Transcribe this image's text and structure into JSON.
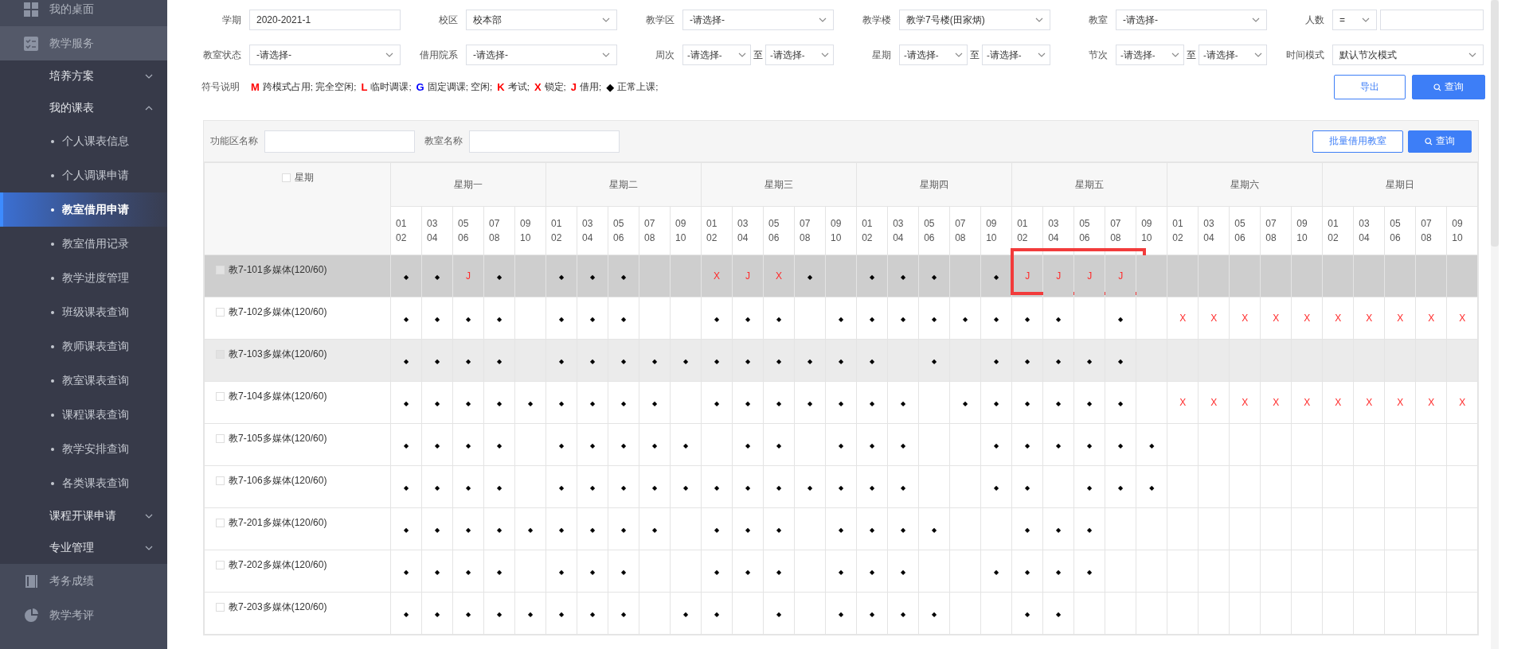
{
  "sidebar": {
    "items": [
      {
        "label": "我的桌面",
        "expanded": false
      },
      {
        "label": "教学服务",
        "expanded": true,
        "children": [
          {
            "label": "培养方案",
            "expanded": false
          },
          {
            "label": "我的课表",
            "expanded": true,
            "children": [
              {
                "label": "个人课表信息",
                "selected": false
              },
              {
                "label": "个人调课申请",
                "selected": false
              },
              {
                "label": "教室借用申请",
                "selected": true
              },
              {
                "label": "教室借用记录",
                "selected": false
              },
              {
                "label": "教学进度管理",
                "selected": false
              },
              {
                "label": "班级课表查询",
                "selected": false
              },
              {
                "label": "教师课表查询",
                "selected": false
              },
              {
                "label": "教室课表查询",
                "selected": false
              },
              {
                "label": "课程课表查询",
                "selected": false
              },
              {
                "label": "教学安排查询",
                "selected": false
              },
              {
                "label": "各类课表查询",
                "selected": false
              }
            ]
          },
          {
            "label": "课程开课申请",
            "expanded": false
          },
          {
            "label": "专业管理",
            "expanded": false
          }
        ]
      },
      {
        "label": "考务成绩",
        "expanded": false
      },
      {
        "label": "教学考评",
        "expanded": false
      }
    ]
  },
  "filters": [
    {
      "label": "学期",
      "kind": "input",
      "value": "2020-2021-1"
    },
    {
      "label": "校区",
      "kind": "select",
      "value": "校本部"
    },
    {
      "label": "教学区",
      "kind": "select",
      "value": "-请选择-"
    },
    {
      "label": "教学楼",
      "kind": "select",
      "value": "教学7号楼(田家炳)"
    },
    {
      "label": "教室",
      "kind": "select",
      "value": "-请选择-"
    },
    {
      "label": "人数",
      "kind": "compare",
      "operator": "="
    },
    {
      "label": "教室状态",
      "kind": "select",
      "value": "-请选择-"
    },
    {
      "label": "借用院系",
      "kind": "select",
      "value": "-请选择-"
    },
    {
      "label": "周次",
      "kind": "range",
      "from": "-请选择-",
      "separator": "至",
      "to": "-请选择-"
    },
    {
      "label": "星期",
      "kind": "range",
      "from": "-请选择-",
      "separator": "至",
      "to": "-请选择-"
    },
    {
      "label": "节次",
      "kind": "range",
      "from": "-请选择-",
      "separator": "至",
      "to": "-请选择-"
    },
    {
      "label": "时间模式",
      "kind": "select",
      "value": "默认节次模式"
    }
  ],
  "legend": {
    "label": "符号说明",
    "items": [
      {
        "symbol": "M",
        "text": "跨模式占用; 完全空闲;",
        "color": "#ff0000"
      },
      {
        "symbol": "L",
        "text": "临时调课;",
        "color": "#ff0000"
      },
      {
        "symbol": "G",
        "text": "固定调课; 空闲;",
        "color": "#0000ff"
      },
      {
        "symbol": "K",
        "text": "考试;",
        "color": "#ff0000"
      },
      {
        "symbol": "X",
        "text": "锁定;",
        "color": "#ff0000"
      },
      {
        "symbol": "J",
        "text": "借用;",
        "color": "#ff0000"
      },
      {
        "symbol": "◆",
        "text": "正常上课;",
        "color": "#000000"
      }
    ]
  },
  "actions": [
    {
      "label": "导出",
      "kind": "outline"
    },
    {
      "label": "查询",
      "kind": "primary"
    }
  ],
  "table": {
    "toolbar": {
      "fields": [
        {
          "label": "功能区名称"
        },
        {
          "label": "教室名称"
        }
      ],
      "buttons": [
        {
          "label": "批量借用教室",
          "kind": "outline"
        },
        {
          "label": "查询",
          "kind": "primary"
        }
      ]
    },
    "corner": {
      "label": "星期",
      "checked": false
    },
    "days": [
      {
        "label": "星期一",
        "periods": [
          "01\n02",
          "03\n04",
          "05\n06",
          "07\n08",
          "09\n10"
        ]
      },
      {
        "label": "星期二",
        "periods": [
          "01\n02",
          "03\n04",
          "05\n06",
          "07\n08",
          "09\n10"
        ]
      },
      {
        "label": "星期三",
        "periods": [
          "01\n02",
          "03\n04",
          "05\n06",
          "07\n08",
          "09\n10"
        ]
      },
      {
        "label": "星期四",
        "periods": [
          "01\n02",
          "03\n04",
          "05\n06",
          "07\n08",
          "09\n10"
        ]
      },
      {
        "label": "星期五",
        "periods": [
          "01\n02",
          "03\n04",
          "05\n06",
          "07\n08",
          "09\n10"
        ]
      },
      {
        "label": "星期六",
        "periods": [
          "01\n02",
          "03\n04",
          "05\n06",
          "07\n08",
          "09\n10"
        ]
      },
      {
        "label": "星期日",
        "periods": [
          "01\n02",
          "03\n04",
          "05\n06",
          "07\n08",
          "09\n10"
        ]
      }
    ],
    "rows": [
      {
        "room": "教7-101多媒体(120/60)",
        "checked": false,
        "selected": true,
        "hovered": false,
        "days": [
          {
            "slots": [
              {
                "mark": "◆",
                "kind": "normal"
              },
              {
                "mark": "◆",
                "kind": "normal"
              },
              {
                "mark": "J",
                "kind": "borrow"
              },
              {
                "mark": "◆",
                "kind": "normal"
              },
              {
                "kind": "free"
              }
            ]
          },
          {
            "slots": [
              {
                "mark": "◆",
                "kind": "normal"
              },
              {
                "mark": "◆",
                "kind": "normal"
              },
              {
                "mark": "◆",
                "kind": "normal"
              },
              {
                "kind": "free"
              },
              {
                "kind": "free"
              }
            ]
          },
          {
            "slots": [
              {
                "mark": "X",
                "kind": "locked"
              },
              {
                "mark": "J",
                "kind": "borrow"
              },
              {
                "mark": "X",
                "kind": "locked"
              },
              {
                "mark": "◆",
                "kind": "normal"
              },
              {
                "kind": "free"
              }
            ]
          },
          {
            "slots": [
              {
                "mark": "◆",
                "kind": "normal"
              },
              {
                "mark": "◆",
                "kind": "normal"
              },
              {
                "mark": "◆",
                "kind": "normal"
              },
              {
                "kind": "free"
              },
              {
                "mark": "◆",
                "kind": "normal"
              }
            ]
          },
          {
            "slots": [
              {
                "mark": "J",
                "kind": "borrow"
              },
              {
                "mark": "J",
                "kind": "borrow"
              },
              {
                "mark": "J",
                "kind": "borrow"
              },
              {
                "mark": "J",
                "kind": "borrow"
              },
              {
                "kind": "free"
              }
            ],
            "annotated": true
          },
          {
            "slots": [
              {
                "kind": "free"
              },
              {
                "kind": "free"
              },
              {
                "kind": "free"
              },
              {
                "kind": "free"
              },
              {
                "kind": "free"
              }
            ]
          },
          {
            "slots": [
              {
                "kind": "free"
              },
              {
                "kind": "free"
              },
              {
                "kind": "free"
              },
              {
                "kind": "free"
              },
              {
                "kind": "free"
              }
            ]
          }
        ]
      },
      {
        "room": "教7-102多媒体(120/60)",
        "checked": false,
        "selected": false,
        "hovered": false,
        "days": [
          {
            "slots": [
              {
                "mark": "◆",
                "kind": "normal"
              },
              {
                "mark": "◆",
                "kind": "normal"
              },
              {
                "mark": "◆",
                "kind": "normal"
              },
              {
                "mark": "◆",
                "kind": "normal"
              },
              {
                "kind": "free"
              }
            ]
          },
          {
            "slots": [
              {
                "mark": "◆",
                "kind": "normal"
              },
              {
                "mark": "◆",
                "kind": "normal"
              },
              {
                "mark": "◆",
                "kind": "normal"
              },
              {
                "kind": "free"
              },
              {
                "kind": "free"
              }
            ]
          },
          {
            "slots": [
              {
                "mark": "◆",
                "kind": "normal"
              },
              {
                "mark": "◆",
                "kind": "normal"
              },
              {
                "mark": "◆",
                "kind": "normal"
              },
              {
                "kind": "free"
              },
              {
                "mark": "◆",
                "kind": "normal"
              }
            ]
          },
          {
            "slots": [
              {
                "mark": "◆",
                "kind": "normal"
              },
              {
                "mark": "◆",
                "kind": "normal"
              },
              {
                "mark": "◆",
                "kind": "normal"
              },
              {
                "mark": "◆",
                "kind": "normal"
              },
              {
                "mark": "◆",
                "kind": "normal"
              }
            ]
          },
          {
            "slots": [
              {
                "mark": "◆",
                "kind": "normal"
              },
              {
                "mark": "◆",
                "kind": "normal"
              },
              {
                "kind": "free"
              },
              {
                "mark": "◆",
                "kind": "normal"
              },
              {
                "kind": "free"
              }
            ]
          },
          {
            "slots": [
              {
                "mark": "X",
                "kind": "locked"
              },
              {
                "mark": "X",
                "kind": "locked"
              },
              {
                "mark": "X",
                "kind": "locked"
              },
              {
                "mark": "X",
                "kind": "locked"
              },
              {
                "mark": "X",
                "kind": "locked"
              }
            ]
          },
          {
            "slots": [
              {
                "mark": "X",
                "kind": "locked"
              },
              {
                "mark": "X",
                "kind": "locked"
              },
              {
                "mark": "X",
                "kind": "locked"
              },
              {
                "mark": "X",
                "kind": "locked"
              },
              {
                "mark": "X",
                "kind": "locked"
              }
            ]
          }
        ]
      },
      {
        "room": "教7-103多媒体(120/60)",
        "checked": false,
        "selected": false,
        "hovered": true,
        "days": [
          {
            "slots": [
              {
                "mark": "◆",
                "kind": "normal"
              },
              {
                "mark": "◆",
                "kind": "normal"
              },
              {
                "mark": "◆",
                "kind": "normal"
              },
              {
                "mark": "◆",
                "kind": "normal"
              },
              {
                "kind": "free"
              }
            ]
          },
          {
            "slots": [
              {
                "mark": "◆",
                "kind": "normal"
              },
              {
                "mark": "◆",
                "kind": "normal"
              },
              {
                "mark": "◆",
                "kind": "normal"
              },
              {
                "mark": "◆",
                "kind": "normal"
              },
              {
                "mark": "◆",
                "kind": "normal"
              }
            ]
          },
          {
            "slots": [
              {
                "mark": "◆",
                "kind": "normal"
              },
              {
                "mark": "◆",
                "kind": "normal"
              },
              {
                "mark": "◆",
                "kind": "normal"
              },
              {
                "mark": "◆",
                "kind": "normal"
              },
              {
                "mark": "◆",
                "kind": "normal"
              }
            ]
          },
          {
            "slots": [
              {
                "mark": "◆",
                "kind": "normal"
              },
              {
                "kind": "free"
              },
              {
                "mark": "◆",
                "kind": "normal"
              },
              {
                "kind": "free"
              },
              {
                "mark": "◆",
                "kind": "normal"
              }
            ]
          },
          {
            "slots": [
              {
                "mark": "◆",
                "kind": "normal"
              },
              {
                "mark": "◆",
                "kind": "normal"
              },
              {
                "mark": "◆",
                "kind": "normal"
              },
              {
                "mark": "◆",
                "kind": "normal"
              },
              {
                "kind": "free"
              }
            ]
          },
          {
            "slots": [
              {
                "kind": "free"
              },
              {
                "kind": "free"
              },
              {
                "kind": "free"
              },
              {
                "kind": "free"
              },
              {
                "kind": "free"
              }
            ]
          },
          {
            "slots": [
              {
                "kind": "free"
              },
              {
                "kind": "free"
              },
              {
                "kind": "free"
              },
              {
                "kind": "free"
              },
              {
                "kind": "free"
              }
            ]
          }
        ]
      },
      {
        "room": "教7-104多媒体(120/60)",
        "checked": false,
        "selected": false,
        "hovered": false,
        "days": [
          {
            "slots": [
              {
                "mark": "◆",
                "kind": "normal"
              },
              {
                "mark": "◆",
                "kind": "normal"
              },
              {
                "mark": "◆",
                "kind": "normal"
              },
              {
                "mark": "◆",
                "kind": "normal"
              },
              {
                "mark": "◆",
                "kind": "normal"
              }
            ]
          },
          {
            "slots": [
              {
                "mark": "◆",
                "kind": "normal"
              },
              {
                "mark": "◆",
                "kind": "normal"
              },
              {
                "mark": "◆",
                "kind": "normal"
              },
              {
                "mark": "◆",
                "kind": "normal"
              },
              {
                "kind": "free"
              }
            ]
          },
          {
            "slots": [
              {
                "mark": "◆",
                "kind": "normal"
              },
              {
                "mark": "◆",
                "kind": "normal"
              },
              {
                "mark": "◆",
                "kind": "normal"
              },
              {
                "mark": "◆",
                "kind": "normal"
              },
              {
                "mark": "◆",
                "kind": "normal"
              }
            ]
          },
          {
            "slots": [
              {
                "mark": "◆",
                "kind": "normal"
              },
              {
                "mark": "◆",
                "kind": "normal"
              },
              {
                "kind": "free"
              },
              {
                "mark": "◆",
                "kind": "normal"
              },
              {
                "mark": "◆",
                "kind": "normal"
              }
            ]
          },
          {
            "slots": [
              {
                "mark": "◆",
                "kind": "normal"
              },
              {
                "mark": "◆",
                "kind": "normal"
              },
              {
                "mark": "◆",
                "kind": "normal"
              },
              {
                "mark": "◆",
                "kind": "normal"
              },
              {
                "kind": "free"
              }
            ]
          },
          {
            "slots": [
              {
                "mark": "X",
                "kind": "locked"
              },
              {
                "mark": "X",
                "kind": "locked"
              },
              {
                "mark": "X",
                "kind": "locked"
              },
              {
                "mark": "X",
                "kind": "locked"
              },
              {
                "mark": "X",
                "kind": "locked"
              }
            ]
          },
          {
            "slots": [
              {
                "mark": "X",
                "kind": "locked"
              },
              {
                "mark": "X",
                "kind": "locked"
              },
              {
                "mark": "X",
                "kind": "locked"
              },
              {
                "mark": "X",
                "kind": "locked"
              },
              {
                "mark": "X",
                "kind": "locked"
              }
            ]
          }
        ]
      },
      {
        "room": "教7-105多媒体(120/60)",
        "checked": false,
        "selected": false,
        "hovered": false,
        "days": [
          {
            "slots": [
              {
                "mark": "◆",
                "kind": "normal"
              },
              {
                "mark": "◆",
                "kind": "normal"
              },
              {
                "mark": "◆",
                "kind": "normal"
              },
              {
                "mark": "◆",
                "kind": "normal"
              },
              {
                "kind": "free"
              }
            ]
          },
          {
            "slots": [
              {
                "mark": "◆",
                "kind": "normal"
              },
              {
                "mark": "◆",
                "kind": "normal"
              },
              {
                "mark": "◆",
                "kind": "normal"
              },
              {
                "mark": "◆",
                "kind": "normal"
              },
              {
                "mark": "◆",
                "kind": "normal"
              }
            ]
          },
          {
            "slots": [
              {
                "kind": "free"
              },
              {
                "mark": "◆",
                "kind": "normal"
              },
              {
                "mark": "◆",
                "kind": "normal"
              },
              {
                "kind": "free"
              },
              {
                "mark": "◆",
                "kind": "normal"
              }
            ]
          },
          {
            "slots": [
              {
                "mark": "◆",
                "kind": "normal"
              },
              {
                "mark": "◆",
                "kind": "normal"
              },
              {
                "kind": "free"
              },
              {
                "kind": "free"
              },
              {
                "mark": "◆",
                "kind": "normal"
              }
            ]
          },
          {
            "slots": [
              {
                "mark": "◆",
                "kind": "normal"
              },
              {
                "mark": "◆",
                "kind": "normal"
              },
              {
                "mark": "◆",
                "kind": "normal"
              },
              {
                "mark": "◆",
                "kind": "normal"
              },
              {
                "mark": "◆",
                "kind": "normal"
              }
            ]
          },
          {
            "slots": [
              {
                "kind": "free"
              },
              {
                "kind": "free"
              },
              {
                "kind": "free"
              },
              {
                "kind": "free"
              },
              {
                "kind": "free"
              }
            ]
          },
          {
            "slots": [
              {
                "kind": "free"
              },
              {
                "kind": "free"
              },
              {
                "kind": "free"
              },
              {
                "kind": "free"
              },
              {
                "kind": "free"
              }
            ]
          }
        ]
      },
      {
        "room": "教7-106多媒体(120/60)",
        "checked": false,
        "selected": false,
        "hovered": false,
        "days": [
          {
            "slots": [
              {
                "mark": "◆",
                "kind": "normal"
              },
              {
                "mark": "◆",
                "kind": "normal"
              },
              {
                "mark": "◆",
                "kind": "normal"
              },
              {
                "mark": "◆",
                "kind": "normal"
              },
              {
                "kind": "free"
              }
            ]
          },
          {
            "slots": [
              {
                "mark": "◆",
                "kind": "normal"
              },
              {
                "mark": "◆",
                "kind": "normal"
              },
              {
                "mark": "◆",
                "kind": "normal"
              },
              {
                "mark": "◆",
                "kind": "normal"
              },
              {
                "mark": "◆",
                "kind": "normal"
              }
            ]
          },
          {
            "slots": [
              {
                "mark": "◆",
                "kind": "normal"
              },
              {
                "mark": "◆",
                "kind": "normal"
              },
              {
                "mark": "◆",
                "kind": "normal"
              },
              {
                "mark": "◆",
                "kind": "normal"
              },
              {
                "mark": "◆",
                "kind": "normal"
              }
            ]
          },
          {
            "slots": [
              {
                "mark": "◆",
                "kind": "normal"
              },
              {
                "mark": "◆",
                "kind": "normal"
              },
              {
                "kind": "free"
              },
              {
                "kind": "free"
              },
              {
                "mark": "◆",
                "kind": "normal"
              }
            ]
          },
          {
            "slots": [
              {
                "mark": "◆",
                "kind": "normal"
              },
              {
                "kind": "free"
              },
              {
                "mark": "◆",
                "kind": "normal"
              },
              {
                "mark": "◆",
                "kind": "normal"
              },
              {
                "mark": "◆",
                "kind": "normal"
              }
            ]
          },
          {
            "slots": [
              {
                "kind": "free"
              },
              {
                "kind": "free"
              },
              {
                "kind": "free"
              },
              {
                "kind": "free"
              },
              {
                "kind": "free"
              }
            ]
          },
          {
            "slots": [
              {
                "kind": "free"
              },
              {
                "kind": "free"
              },
              {
                "kind": "free"
              },
              {
                "kind": "free"
              },
              {
                "kind": "free"
              }
            ]
          }
        ]
      },
      {
        "room": "教7-201多媒体(120/60)",
        "checked": false,
        "selected": false,
        "hovered": false,
        "days": [
          {
            "slots": [
              {
                "mark": "◆",
                "kind": "normal"
              },
              {
                "mark": "◆",
                "kind": "normal"
              },
              {
                "mark": "◆",
                "kind": "normal"
              },
              {
                "mark": "◆",
                "kind": "normal"
              },
              {
                "mark": "◆",
                "kind": "normal"
              }
            ]
          },
          {
            "slots": [
              {
                "mark": "◆",
                "kind": "normal"
              },
              {
                "mark": "◆",
                "kind": "normal"
              },
              {
                "mark": "◆",
                "kind": "normal"
              },
              {
                "mark": "◆",
                "kind": "normal"
              },
              {
                "kind": "free"
              }
            ]
          },
          {
            "slots": [
              {
                "mark": "◆",
                "kind": "normal"
              },
              {
                "mark": "◆",
                "kind": "normal"
              },
              {
                "mark": "◆",
                "kind": "normal"
              },
              {
                "kind": "free"
              },
              {
                "mark": "◆",
                "kind": "normal"
              }
            ]
          },
          {
            "slots": [
              {
                "mark": "◆",
                "kind": "normal"
              },
              {
                "mark": "◆",
                "kind": "normal"
              },
              {
                "mark": "◆",
                "kind": "normal"
              },
              {
                "kind": "free"
              },
              {
                "kind": "free"
              }
            ]
          },
          {
            "slots": [
              {
                "mark": "◆",
                "kind": "normal"
              },
              {
                "mark": "◆",
                "kind": "normal"
              },
              {
                "mark": "◆",
                "kind": "normal"
              },
              {
                "kind": "free"
              },
              {
                "kind": "free"
              }
            ]
          },
          {
            "slots": [
              {
                "kind": "free"
              },
              {
                "kind": "free"
              },
              {
                "kind": "free"
              },
              {
                "kind": "free"
              },
              {
                "kind": "free"
              }
            ]
          },
          {
            "slots": [
              {
                "kind": "free"
              },
              {
                "kind": "free"
              },
              {
                "kind": "free"
              },
              {
                "kind": "free"
              },
              {
                "kind": "free"
              }
            ]
          }
        ]
      },
      {
        "room": "教7-202多媒体(120/60)",
        "checked": false,
        "selected": false,
        "hovered": false,
        "days": [
          {
            "slots": [
              {
                "mark": "◆",
                "kind": "normal"
              },
              {
                "mark": "◆",
                "kind": "normal"
              },
              {
                "mark": "◆",
                "kind": "normal"
              },
              {
                "mark": "◆",
                "kind": "normal"
              },
              {
                "kind": "free"
              }
            ]
          },
          {
            "slots": [
              {
                "mark": "◆",
                "kind": "normal"
              },
              {
                "mark": "◆",
                "kind": "normal"
              },
              {
                "mark": "◆",
                "kind": "normal"
              },
              {
                "kind": "free"
              },
              {
                "kind": "free"
              }
            ]
          },
          {
            "slots": [
              {
                "mark": "◆",
                "kind": "normal"
              },
              {
                "mark": "◆",
                "kind": "normal"
              },
              {
                "mark": "◆",
                "kind": "normal"
              },
              {
                "kind": "free"
              },
              {
                "mark": "◆",
                "kind": "normal"
              }
            ]
          },
          {
            "slots": [
              {
                "mark": "◆",
                "kind": "normal"
              },
              {
                "mark": "◆",
                "kind": "normal"
              },
              {
                "kind": "free"
              },
              {
                "kind": "free"
              },
              {
                "mark": "◆",
                "kind": "normal"
              }
            ]
          },
          {
            "slots": [
              {
                "mark": "◆",
                "kind": "normal"
              },
              {
                "mark": "◆",
                "kind": "normal"
              },
              {
                "mark": "◆",
                "kind": "normal"
              },
              {
                "kind": "free"
              },
              {
                "kind": "free"
              }
            ]
          },
          {
            "slots": [
              {
                "kind": "free"
              },
              {
                "kind": "free"
              },
              {
                "kind": "free"
              },
              {
                "kind": "free"
              },
              {
                "kind": "free"
              }
            ]
          },
          {
            "slots": [
              {
                "kind": "free"
              },
              {
                "kind": "free"
              },
              {
                "kind": "free"
              },
              {
                "kind": "free"
              },
              {
                "kind": "free"
              }
            ]
          }
        ]
      },
      {
        "room": "教7-203多媒体(120/60)",
        "checked": false,
        "selected": false,
        "hovered": false,
        "days": [
          {
            "slots": [
              {
                "mark": "◆",
                "kind": "normal"
              },
              {
                "mark": "◆",
                "kind": "normal"
              },
              {
                "mark": "◆",
                "kind": "normal"
              },
              {
                "mark": "◆",
                "kind": "normal"
              },
              {
                "mark": "◆",
                "kind": "normal"
              }
            ]
          },
          {
            "slots": [
              {
                "mark": "◆",
                "kind": "normal"
              },
              {
                "mark": "◆",
                "kind": "normal"
              },
              {
                "mark": "◆",
                "kind": "normal"
              },
              {
                "kind": "free"
              },
              {
                "mark": "◆",
                "kind": "normal"
              }
            ]
          },
          {
            "slots": [
              {
                "mark": "◆",
                "kind": "normal"
              },
              {
                "kind": "free"
              },
              {
                "mark": "◆",
                "kind": "normal"
              },
              {
                "kind": "free"
              },
              {
                "mark": "◆",
                "kind": "normal"
              }
            ]
          },
          {
            "slots": [
              {
                "mark": "◆",
                "kind": "normal"
              },
              {
                "mark": "◆",
                "kind": "normal"
              },
              {
                "mark": "◆",
                "kind": "normal"
              },
              {
                "kind": "free"
              },
              {
                "kind": "free"
              }
            ]
          },
          {
            "slots": [
              {
                "mark": "◆",
                "kind": "normal"
              },
              {
                "mark": "◆",
                "kind": "normal"
              },
              {
                "kind": "free"
              },
              {
                "kind": "free"
              },
              {
                "kind": "free"
              }
            ]
          },
          {
            "slots": [
              {
                "kind": "free"
              },
              {
                "kind": "free"
              },
              {
                "kind": "free"
              },
              {
                "kind": "free"
              },
              {
                "kind": "free"
              }
            ]
          },
          {
            "slots": [
              {
                "kind": "free"
              },
              {
                "kind": "free"
              },
              {
                "kind": "free"
              },
              {
                "kind": "free"
              },
              {
                "kind": "free"
              }
            ]
          }
        ]
      }
    ]
  }
}
